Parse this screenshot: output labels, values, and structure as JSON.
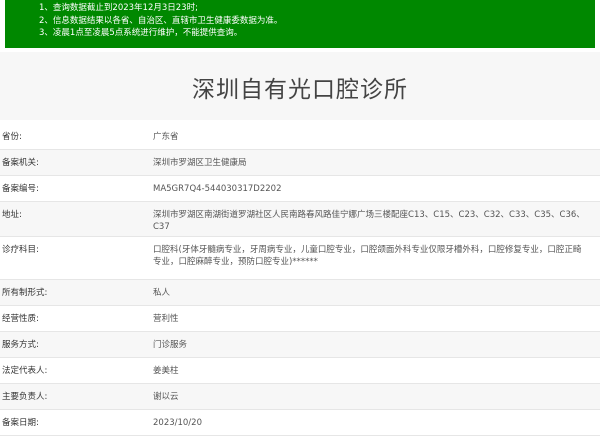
{
  "notice": {
    "lines": [
      "1、查询数据截止到2023年12月3日23时;",
      "2、信息数据结果以各省、自治区、直辖市卫生健康委数据为准。",
      "3、凌晨1点至凌晨5点系统进行维护，不能提供查询。"
    ]
  },
  "page_title": "深圳自有光口腔诊所",
  "fields": [
    {
      "label": "省份:",
      "value": "广东省"
    },
    {
      "label": "备案机关:",
      "value": "深圳市罗湖区卫生健康局"
    },
    {
      "label": "备案编号:",
      "value": "MA5GR7Q4-544030317D2202"
    },
    {
      "label": "地址:",
      "value": "深圳市罗湖区南湖街道罗湖社区人民南路春风路佳宁娜广场三楼配座C13、C15、C23、C32、C33、C35、C36、C37"
    },
    {
      "label": "诊疗科目:",
      "value": "口腔科(牙体牙髓病专业，牙周病专业，儿童口腔专业，口腔颌面外科专业仅限牙槽外科，口腔修复专业，口腔正畸专业，口腔麻醉专业，预防口腔专业)******"
    },
    {
      "label": "所有制形式:",
      "value": "私人"
    },
    {
      "label": "经营性质:",
      "value": "营利性"
    },
    {
      "label": "服务方式:",
      "value": "门诊服务"
    },
    {
      "label": "法定代表人:",
      "value": "姜美柱"
    },
    {
      "label": "主要负责人:",
      "value": "谢以云"
    },
    {
      "label": "备案日期:",
      "value": "2023/10/20"
    }
  ]
}
